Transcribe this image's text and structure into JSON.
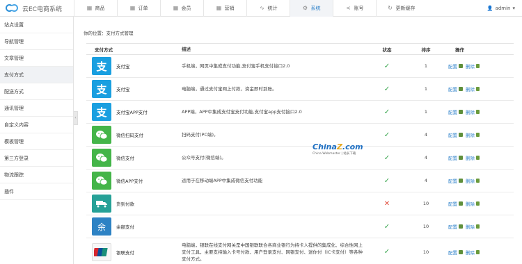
{
  "app": {
    "name": "云EC电商系统"
  },
  "nav": [
    {
      "label": "商品",
      "icon": "grid-icon",
      "active": false
    },
    {
      "label": "订单",
      "icon": "grid-icon",
      "active": false
    },
    {
      "label": "会员",
      "icon": "grid-icon",
      "active": false
    },
    {
      "label": "营销",
      "icon": "grid-icon",
      "active": false
    },
    {
      "label": "统计",
      "icon": "pulse-icon",
      "active": false
    },
    {
      "label": "系统",
      "icon": "gear-icon",
      "active": true
    },
    {
      "label": "账号",
      "icon": "share-icon",
      "active": false
    },
    {
      "label": "更新缓存",
      "icon": "refresh-icon",
      "active": false
    }
  ],
  "user": {
    "name": "admin"
  },
  "sidebar": {
    "items": [
      {
        "label": "站点设置",
        "active": false
      },
      {
        "label": "导航管理",
        "active": false
      },
      {
        "label": "文章管理",
        "active": false
      },
      {
        "label": "支付方式",
        "active": true
      },
      {
        "label": "配送方式",
        "active": false
      },
      {
        "label": "通讯管理",
        "active": false
      },
      {
        "label": "自定义内容",
        "active": false
      },
      {
        "label": "模板管理",
        "active": false
      },
      {
        "label": "第三方登录",
        "active": false
      },
      {
        "label": "物流跟踪",
        "active": false
      },
      {
        "label": "插件",
        "active": false
      }
    ]
  },
  "breadcrumb": "你的位置：支付方式管理",
  "table": {
    "headers": {
      "name": "支付方式",
      "desc": "描述",
      "status": "状态",
      "order": "排序",
      "ops": "操作"
    },
    "rows": [
      {
        "name": "支付宝",
        "icon": "alipay-icon",
        "desc": "手机端，网页中集成支付功能,支付宝手机支付接口2.0",
        "status": "enabled",
        "order": "1",
        "config": "配置",
        "delete": "删除"
      },
      {
        "name": "支付宝",
        "icon": "alipay-icon",
        "desc": "电脑端，通过支付宝网上付款，资金即时到账。",
        "status": "enabled",
        "order": "1",
        "config": "配置",
        "delete": "删除"
      },
      {
        "name": "支付宝APP支付",
        "icon": "alipay-icon",
        "desc": "APP端，APP中集成支付宝支付功能,支付宝app支付接口2.0",
        "status": "enabled",
        "order": "1",
        "config": "配置",
        "delete": "删除"
      },
      {
        "name": "微信扫码支付",
        "icon": "wechat-icon",
        "desc": "扫码支付(PC端)。",
        "status": "enabled",
        "order": "4",
        "config": "配置",
        "delete": "删除"
      },
      {
        "name": "微信支付",
        "icon": "wechat-icon",
        "desc": "公众号支付(微信端)。",
        "status": "enabled",
        "order": "4",
        "config": "配置",
        "delete": "删除"
      },
      {
        "name": "微信APP支付",
        "icon": "wechat-icon",
        "desc": "适用于在移动端APP中集成微信支付功能",
        "status": "enabled",
        "order": "4",
        "config": "配置",
        "delete": "删除"
      },
      {
        "name": "货到付款",
        "icon": "truck-icon",
        "desc": "",
        "status": "disabled",
        "order": "10",
        "config": "配置",
        "delete": "删除"
      },
      {
        "name": "余额支付",
        "icon": "balance-icon",
        "desc": "",
        "status": "enabled",
        "order": "10",
        "config": "配置",
        "delete": "删除"
      },
      {
        "name": "银联支付",
        "icon": "unionpay-icon",
        "desc": "电脑端，银联在线支付网关是中国银联联合各商业银行为持卡人提供的集成化、综合性网上支付工具，主要支持输入卡号付款、用户登录支付、网银支付、迷你付（IC卡支付）等各种支付方式。",
        "status": "enabled",
        "order": "10",
        "config": "配置",
        "delete": "删除"
      }
    ]
  },
  "watermark": {
    "line1": "China",
    "line1b": "Z",
    "line1c": ".com",
    "line2": "China Webmaster | 站长下载"
  },
  "colors": {
    "accent": "#2a7fc9",
    "enabled": "#3aa64f",
    "disabled": "#e14b3a",
    "alipay": "#1a9fe0",
    "wechat": "#44b549"
  }
}
